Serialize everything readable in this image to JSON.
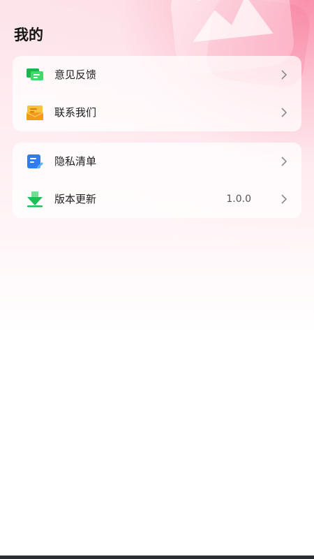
{
  "page": {
    "title": "我的"
  },
  "menu_groups": [
    {
      "items": [
        {
          "label": "意见反馈",
          "icon": "feedback-icon",
          "icon_color": "#2ecc55"
        },
        {
          "label": "联系我们",
          "icon": "contact-icon",
          "icon_color": "#f5b52a"
        }
      ]
    },
    {
      "items": [
        {
          "label": "隐私清单",
          "icon": "privacy-list-icon",
          "icon_color": "#2f7cf0"
        },
        {
          "label": "版本更新",
          "icon": "download-update-icon",
          "icon_color": "#22c55e",
          "value": "1.0.0"
        }
      ]
    }
  ],
  "colors": {
    "accent_pink": "#f78aa5",
    "text": "#1e1e1e",
    "secondary_text": "#555555"
  }
}
